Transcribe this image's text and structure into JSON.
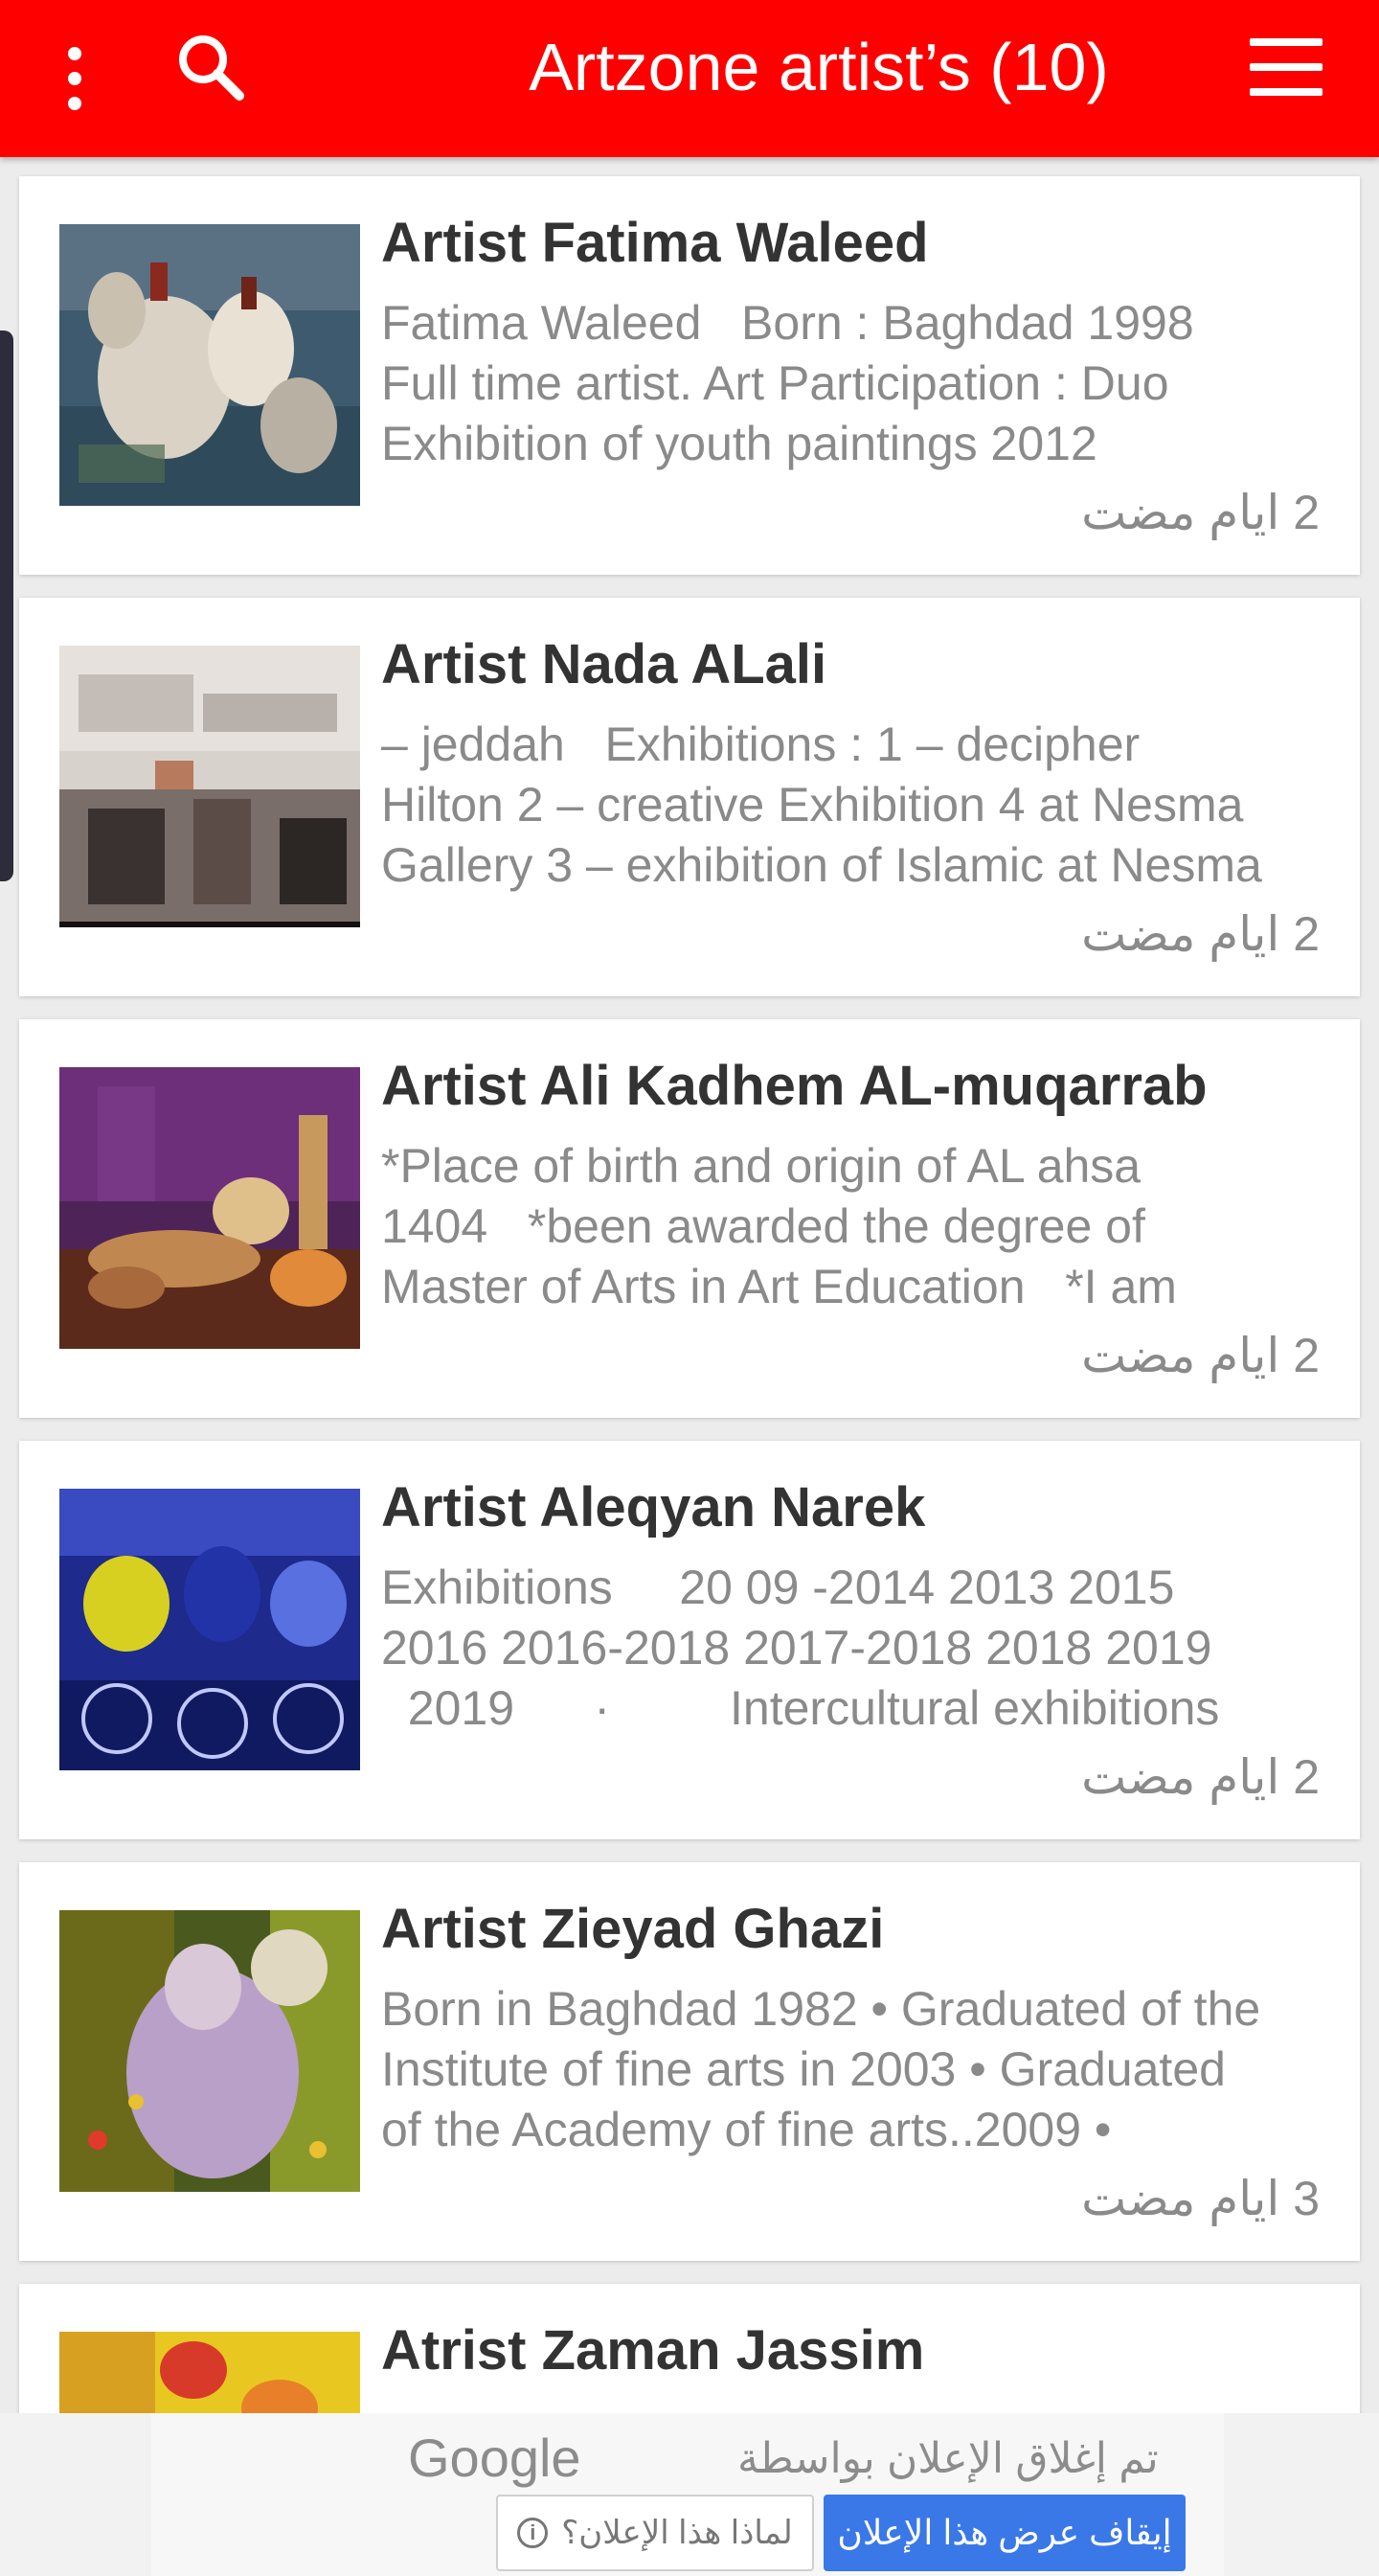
{
  "header": {
    "title": "Artzone artist’s (10)",
    "icons": {
      "more": "more-vert-icon",
      "search": "search-icon",
      "menu": "hamburger-menu-icon"
    },
    "accent_color": "#ff0000"
  },
  "artists": [
    {
      "name": "Artist Fatima Waleed",
      "desc": "Fatima Waleed   Born : Baghdad 1998\nFull time artist. Art Participation : Duo\nExhibition of youth paintings 2012",
      "time": "2 ايام مضت"
    },
    {
      "name": "Artist Nada  ALali",
      "desc": "– jeddah   Exhibitions : 1 – decipher\nHilton 2 – creative Exhibition 4 at Nesma\nGallery 3 – exhibition of Islamic at Nesma",
      "time": "2 ايام مضت"
    },
    {
      "name": "Artist Ali Kadhem AL-muqarrab",
      "desc": "*Place of birth and origin of AL ahsa\n1404   *been awarded the degree of\nMaster of Arts in Art Education   *I am",
      "time": "2 ايام مضت"
    },
    {
      "name": "Artist Aleqyan Narek",
      "desc": "Exhibitions     20 09 -2014 2013 2015\n2016 2016-2018 2017-2018 2018 2019\n  2019      ·         Intercultural exhibitions",
      "time": "2 ايام مضت"
    },
    {
      "name": "Artist Zieyad Ghazi",
      "desc": "Born in Baghdad 1982 • Graduated of the\nInstitute of fine arts in 2003 • Graduated\nof the Academy of fine arts..2009 •",
      "time": "3 ايام مضت"
    },
    {
      "name": "Atrist  Zaman Jassim",
      "desc": "",
      "time": ""
    }
  ],
  "ad": {
    "brand": "Google",
    "closed_text": "تم إغلاق الإعلان بواسطة",
    "why_label": "لماذا هذا الإعلان؟",
    "stop_label": "إيقاف عرض هذا الإعلان",
    "info_icon": "info-icon",
    "stop_color": "#3b78e7"
  }
}
